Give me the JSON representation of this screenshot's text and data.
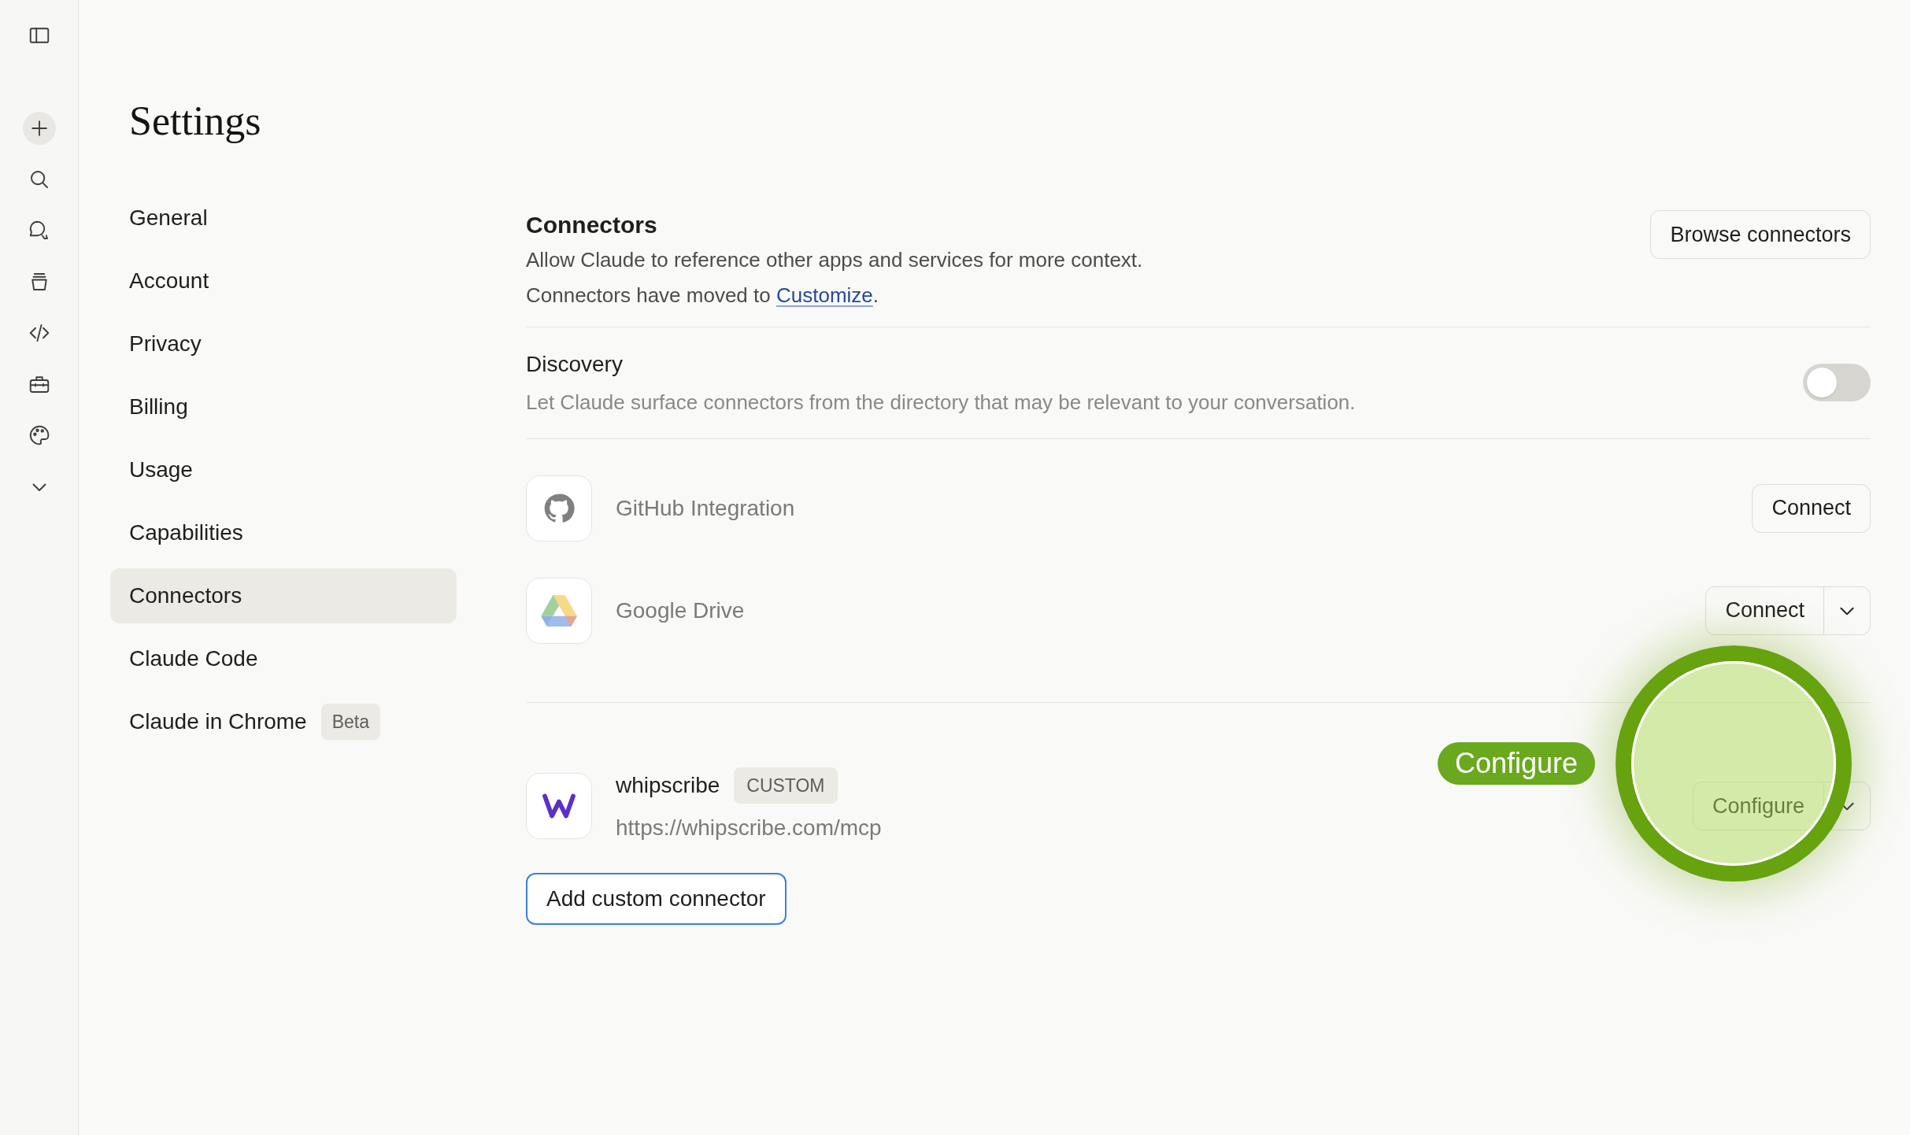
{
  "settings": {
    "title": "Settings"
  },
  "nav": {
    "items": [
      {
        "label": "General",
        "selected": false
      },
      {
        "label": "Account",
        "selected": false
      },
      {
        "label": "Privacy",
        "selected": false
      },
      {
        "label": "Billing",
        "selected": false
      },
      {
        "label": "Usage",
        "selected": false
      },
      {
        "label": "Capabilities",
        "selected": false
      },
      {
        "label": "Connectors",
        "selected": true
      },
      {
        "label": "Claude Code",
        "selected": false
      },
      {
        "label": "Claude in Chrome",
        "selected": false,
        "badge": "Beta"
      }
    ]
  },
  "connectors": {
    "title": "Connectors",
    "description": "Allow Claude to reference other apps and services for more context.",
    "note_before": "Connectors have moved to",
    "note_link": "Customize",
    "note_after": ".",
    "browse_button": "Browse connectors"
  },
  "discovery": {
    "title": "Discovery",
    "description": "Let Claude surface connectors from the directory that may be relevant to your conversation.",
    "on": false
  },
  "integrations": [
    {
      "kind": "github",
      "name": "GitHub Integration",
      "button": "Connect",
      "dropdown": false
    },
    {
      "kind": "drive",
      "name": "Google Drive",
      "button": "Connect",
      "dropdown": true
    }
  ],
  "custom_connectors": [
    {
      "name": "whipscribe",
      "badge": "CUSTOM",
      "url": "https://whipscribe.com/mcp",
      "button": "Configure",
      "dropdown": true
    }
  ],
  "add_button": "Add custom connector",
  "highlight": {
    "label": "Configure"
  }
}
